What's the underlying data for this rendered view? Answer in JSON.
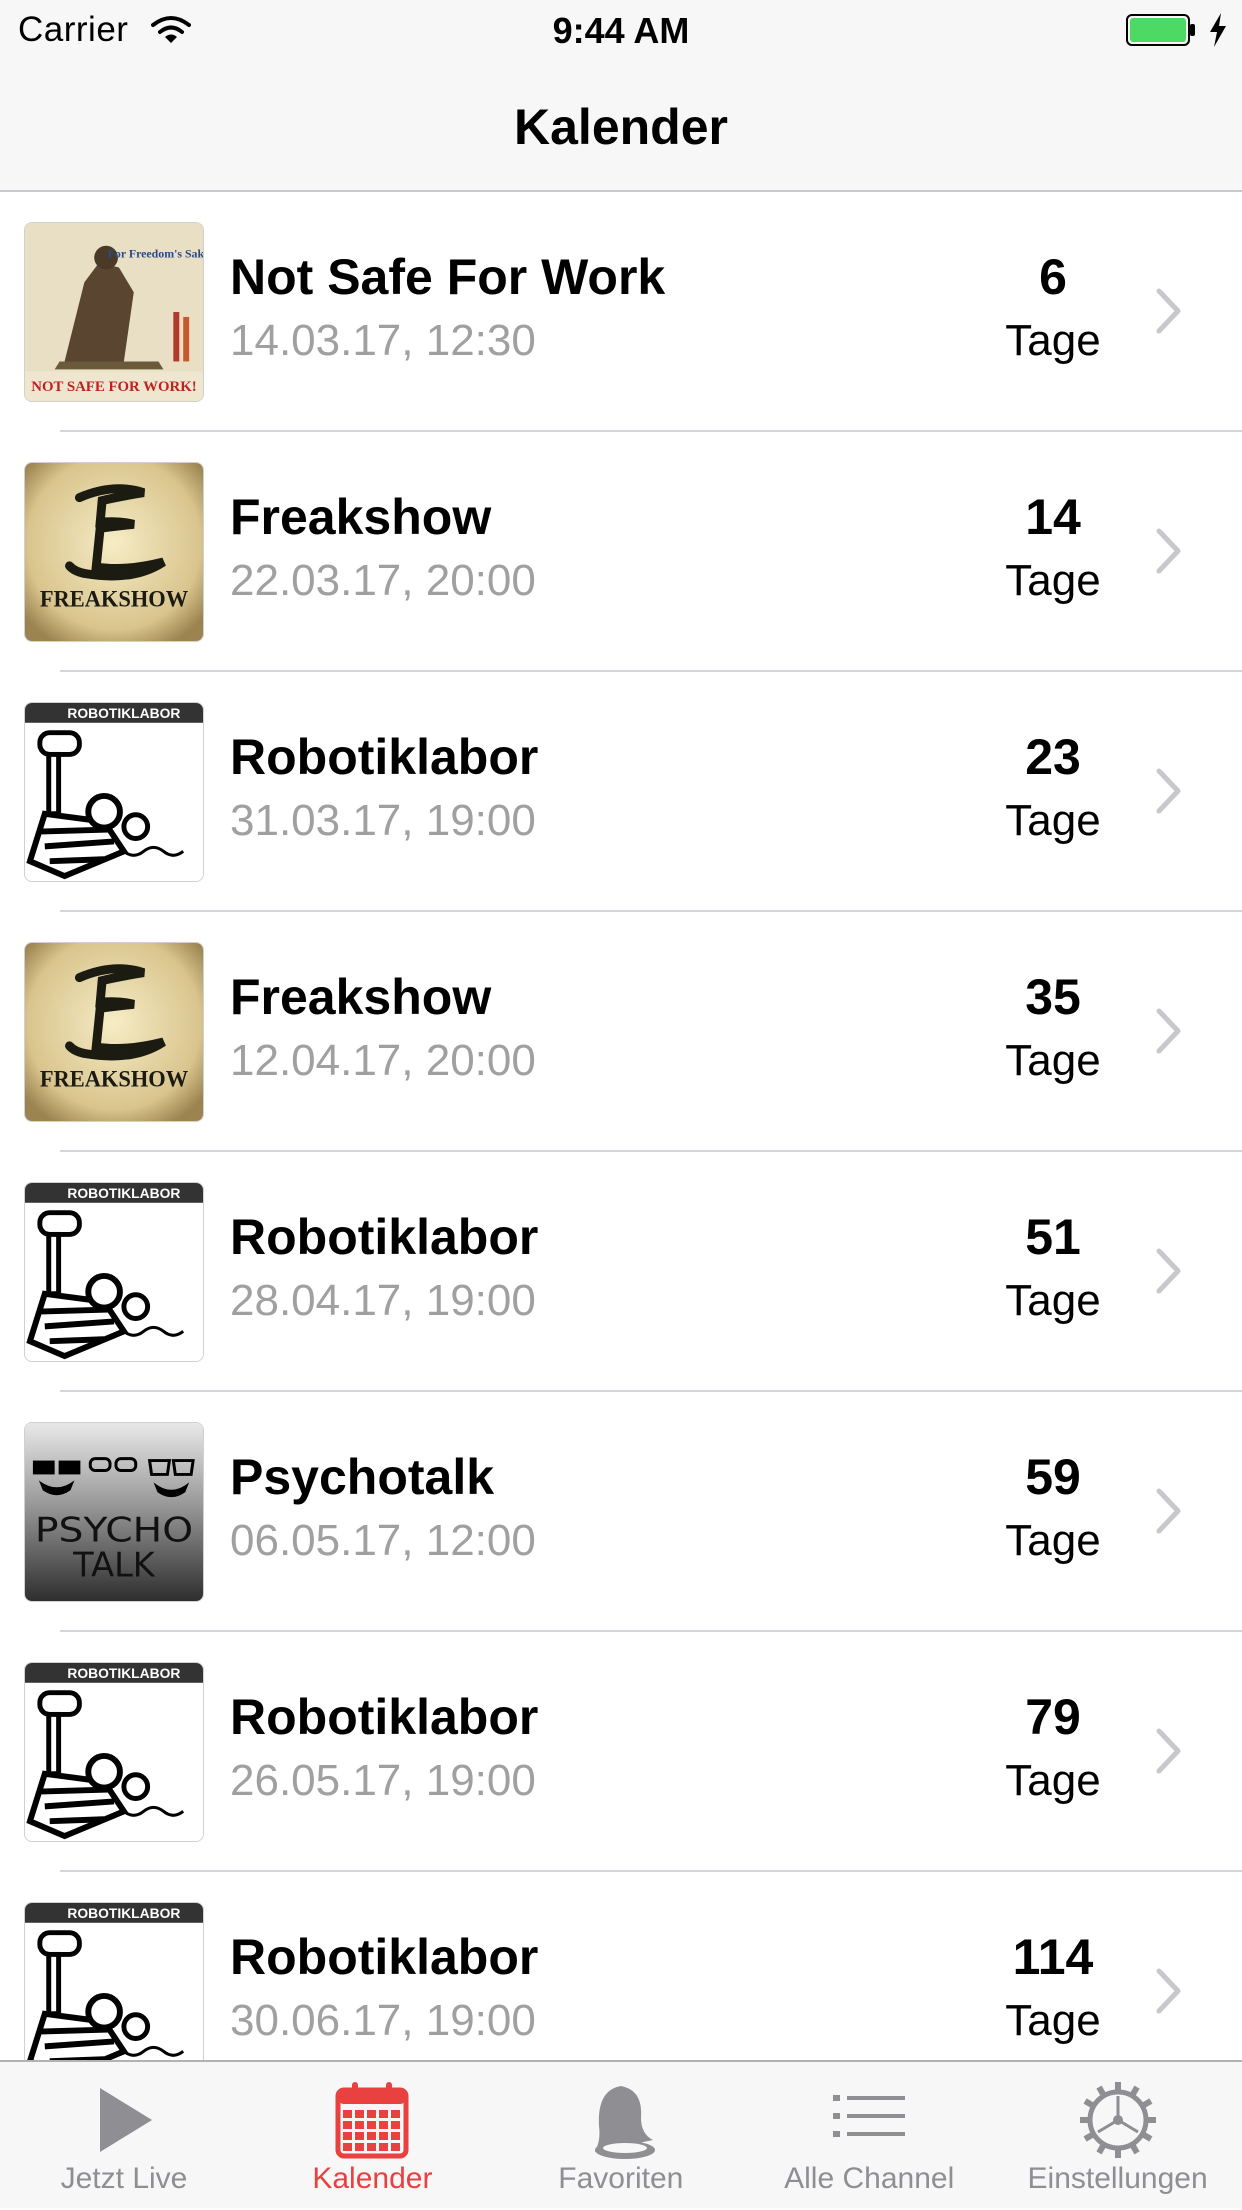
{
  "status_bar": {
    "carrier": "Carrier",
    "time": "9:44 AM"
  },
  "nav": {
    "title": "Kalender"
  },
  "colors": {
    "accent": "#e8413f",
    "inactive": "#8e8e93",
    "secondary_text": "#a0a0a0",
    "battery": "#4cd964"
  },
  "events": [
    {
      "title": "Not Safe For Work",
      "date": "14.03.17, 12:30",
      "count": "6",
      "unit": "Tage",
      "artwork": "nsfw-artwork",
      "artwork_text": [
        "For Freedom's Sake",
        "NOT SAFE FOR WORK!"
      ]
    },
    {
      "title": "Freakshow",
      "date": "22.03.17, 20:00",
      "count": "14",
      "unit": "Tage",
      "artwork": "freakshow-artwork",
      "artwork_text": [
        "FREAKSHOW"
      ]
    },
    {
      "title": "Robotiklabor",
      "date": "31.03.17, 19:00",
      "count": "23",
      "unit": "Tage",
      "artwork": "robotiklabor-artwork",
      "artwork_text": [
        "ROBOTIKLABOR"
      ]
    },
    {
      "title": "Freakshow",
      "date": "12.04.17, 20:00",
      "count": "35",
      "unit": "Tage",
      "artwork": "freakshow-artwork",
      "artwork_text": [
        "FREAKSHOW"
      ]
    },
    {
      "title": "Robotiklabor",
      "date": "28.04.17, 19:00",
      "count": "51",
      "unit": "Tage",
      "artwork": "robotiklabor-artwork",
      "artwork_text": [
        "ROBOTIKLABOR"
      ]
    },
    {
      "title": "Psychotalk",
      "date": "06.05.17, 12:00",
      "count": "59",
      "unit": "Tage",
      "artwork": "psychotalk-artwork",
      "artwork_text": [
        "PSYCHO",
        "TALK"
      ]
    },
    {
      "title": "Robotiklabor",
      "date": "26.05.17, 19:00",
      "count": "79",
      "unit": "Tage",
      "artwork": "robotiklabor-artwork",
      "artwork_text": [
        "ROBOTIKLABOR"
      ]
    },
    {
      "title": "Robotiklabor",
      "date": "30.06.17, 19:00",
      "count": "114",
      "unit": "Tage",
      "artwork": "robotiklabor-artwork",
      "artwork_text": [
        "ROBOTIKLABOR"
      ]
    }
  ],
  "tabs": [
    {
      "label": "Jetzt Live",
      "icon": "play-icon",
      "active": false
    },
    {
      "label": "Kalender",
      "icon": "calendar-icon",
      "active": true
    },
    {
      "label": "Favoriten",
      "icon": "bell-icon",
      "active": false
    },
    {
      "label": "Alle Channel",
      "icon": "list-icon",
      "active": false
    },
    {
      "label": "Einstellungen",
      "icon": "gear-icon",
      "active": false
    }
  ]
}
